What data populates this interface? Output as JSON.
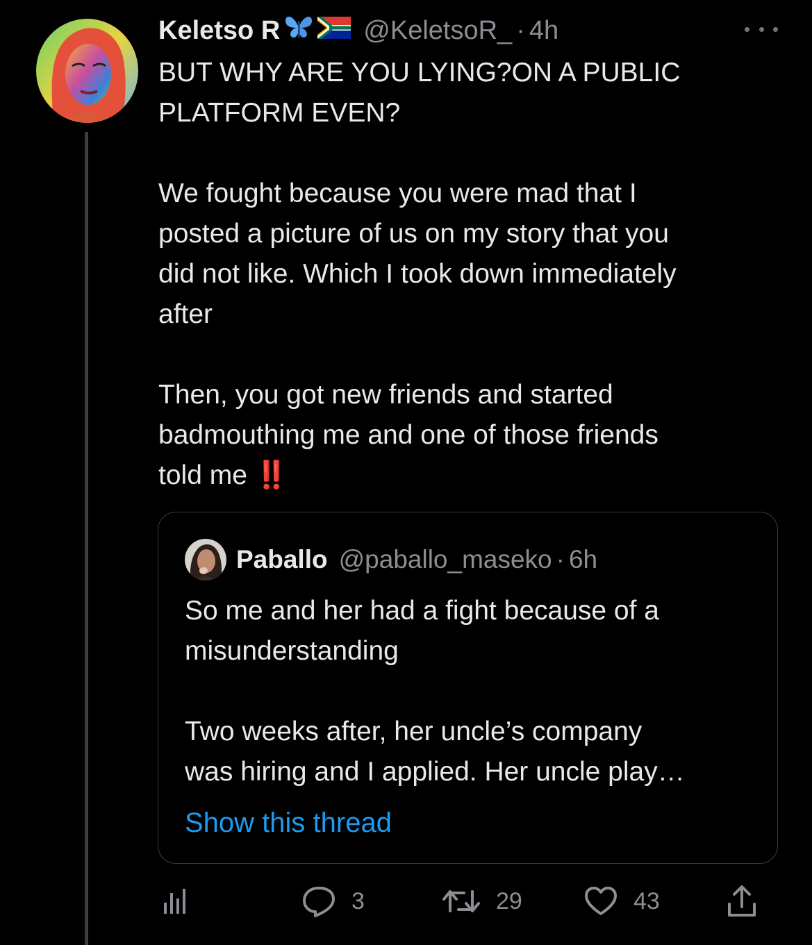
{
  "tweet": {
    "author_name": "Keletso R",
    "author_emojis": [
      "butterfly-emoji",
      "south-africa-flag-emoji"
    ],
    "handle": "@KeletsoR_",
    "separator": "·",
    "time": "4h",
    "paragraphs": [
      [
        "BUT WHY ARE YOU LYING?ON A PUBLIC",
        "PLATFORM EVEN?"
      ],
      [
        "We fought because you were mad that I",
        "posted a picture of us on my story that you",
        "did not like. Which I took down immediately",
        "after"
      ],
      [
        "Then, you got new friends and started",
        "badmouthing me and one of those friends",
        "told me"
      ]
    ],
    "end_emoji": "‼️"
  },
  "quote": {
    "author_name": "Paballo",
    "handle": "@paballo_maseko",
    "separator": "·",
    "time": "6h",
    "paragraphs": [
      [
        "So me and her had a fight because of a",
        "misunderstanding"
      ],
      [
        "Two weeks after, her uncle’s company",
        "was hiring and I applied. Her uncle play…"
      ]
    ],
    "show_thread_label": "Show this thread"
  },
  "actions": {
    "replies": "3",
    "retweets": "29",
    "likes": "43"
  },
  "colors": {
    "background": "#000000",
    "text": "#e7e9ea",
    "muted": "#8b8f94",
    "link": "#1d9bf0",
    "border": "#3a3d41"
  }
}
